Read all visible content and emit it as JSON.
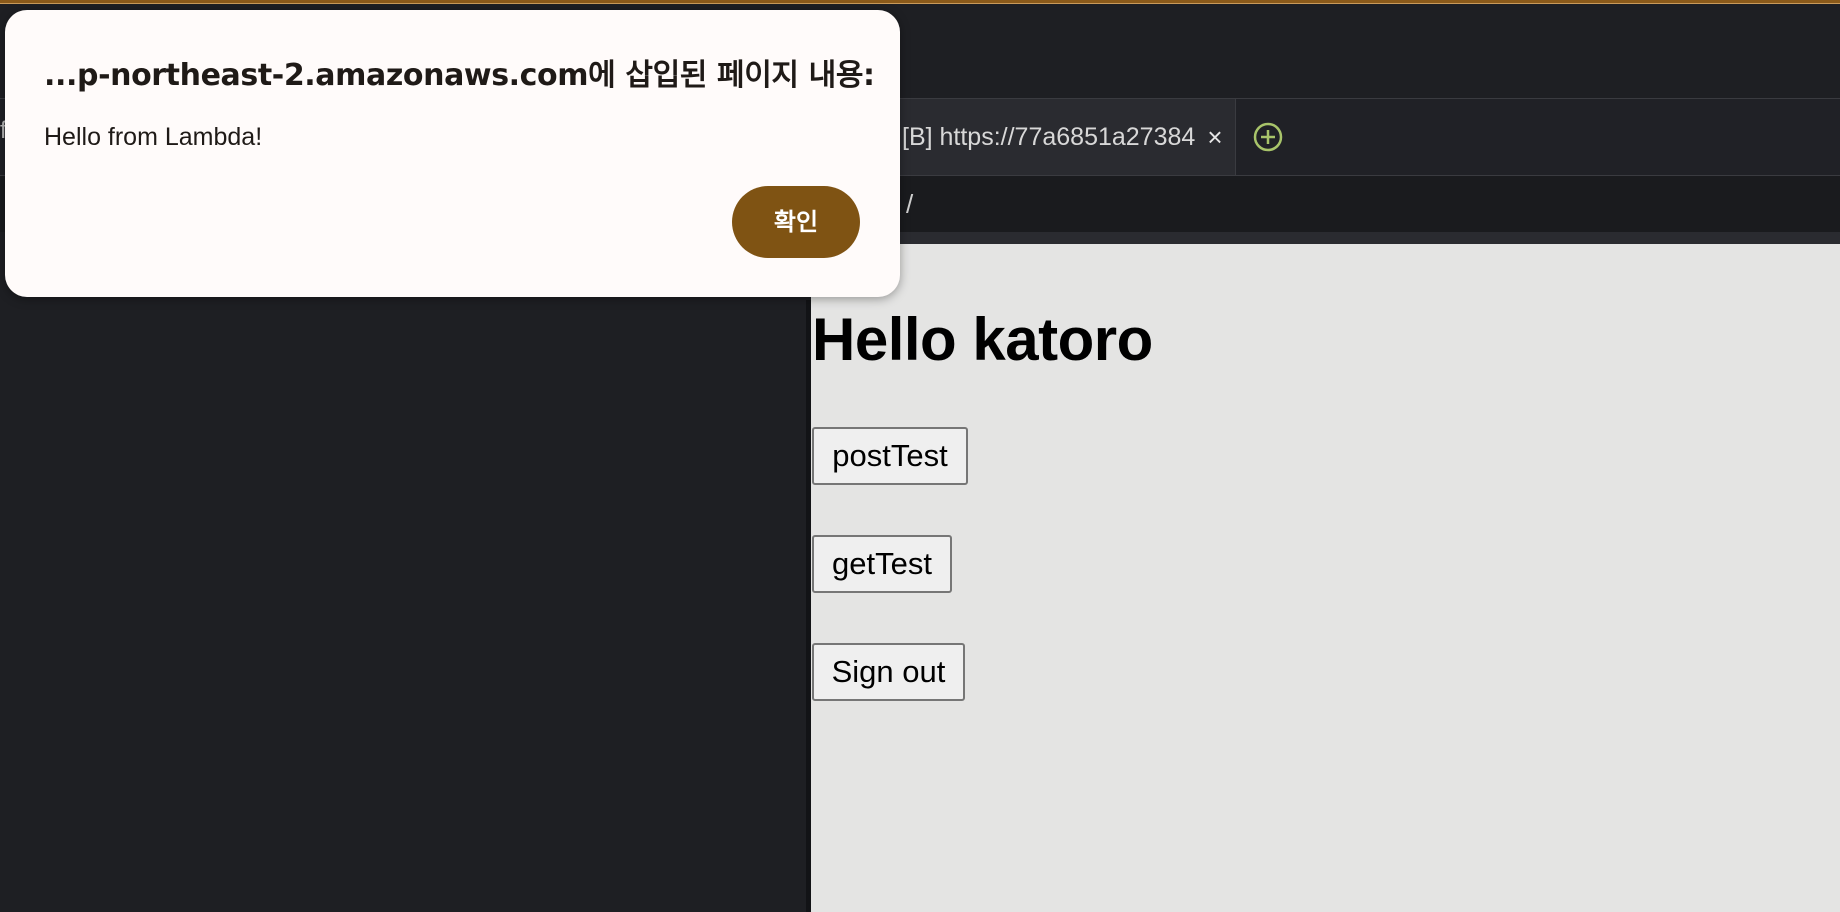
{
  "browser": {
    "tab": {
      "title": "[B] https://77a6851a27384",
      "close_symbol": "×",
      "add_icon": "plus-circle-icon"
    },
    "path_separator": "/"
  },
  "page": {
    "heading": "Hello katoro",
    "buttons": {
      "post_test": "postTest",
      "get_test": "getTest",
      "sign_out": "Sign out"
    }
  },
  "dialog": {
    "title": "...p-northeast-2.amazonaws.com에 삽입된 페이지 내용:",
    "message": "Hello from Lambda!",
    "ok_label": "확인"
  },
  "colors": {
    "accent_brown": "#7f5313",
    "add_icon_green": "#a8c46a",
    "page_background": "#e4e4e3",
    "browser_chrome": "#1e1f23"
  }
}
